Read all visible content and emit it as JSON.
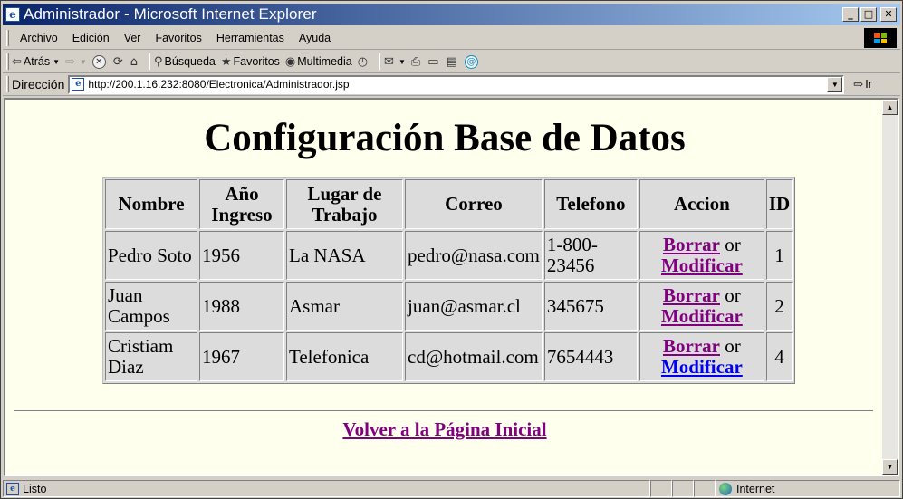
{
  "window": {
    "title": "Administrador - Microsoft Internet Explorer",
    "controls": {
      "minimize": "_",
      "maximize": "□",
      "close": "✕"
    }
  },
  "menu": {
    "items": [
      {
        "label": "Archivo"
      },
      {
        "label": "Edición"
      },
      {
        "label": "Ver"
      },
      {
        "label": "Favoritos"
      },
      {
        "label": "Herramientas"
      },
      {
        "label": "Ayuda"
      }
    ]
  },
  "toolbar": {
    "back_label": "Atrás",
    "search_label": "Búsqueda",
    "favorites_label": "Favoritos",
    "multimedia_label": "Multimedia"
  },
  "address": {
    "label": "Dirección",
    "url": "http://200.1.16.232:8080/Electronica/Administrador.jsp",
    "go_label": "Ir"
  },
  "page": {
    "heading": "Configuración Base de Datos",
    "table": {
      "headers": [
        "Nombre",
        "Año Ingreso",
        "Lugar de Trabajo",
        "Correo",
        "Telefono",
        "Accion",
        "ID"
      ],
      "delete_label": "Borrar",
      "or_label": "or",
      "modify_label": "Modificar",
      "rows": [
        {
          "nombre": "Pedro Soto",
          "anio": "1956",
          "lugar": "La NASA",
          "correo": "pedro@nasa.com",
          "telefono": "1-800-23456",
          "id": "1"
        },
        {
          "nombre": "Juan Campos",
          "anio": "1988",
          "lugar": "Asmar",
          "correo": "juan@asmar.cl",
          "telefono": "345675",
          "id": "2"
        },
        {
          "nombre": "Cristiam Diaz",
          "anio": "1967",
          "lugar": "Telefonica",
          "correo": "cd@hotmail.com",
          "telefono": "7654443",
          "id": "4"
        }
      ]
    },
    "back_link": "Volver a la Página Inicial"
  },
  "status": {
    "text": "Listo",
    "zone": "Internet"
  },
  "colors": {
    "page_background": "#ffffee",
    "visited_link": "#800080",
    "unvisited_link": "#0000ee",
    "title_gradient_start": "#0a246a",
    "title_gradient_end": "#a6caf0"
  }
}
